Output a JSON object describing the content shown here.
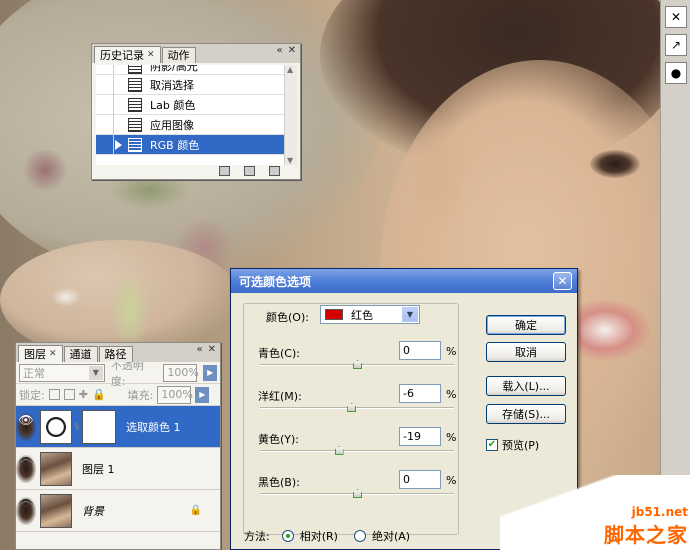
{
  "history": {
    "tabs": [
      {
        "label": "历史记录"
      },
      {
        "label": "动作"
      }
    ],
    "items": [
      {
        "label": "阴影/高光"
      },
      {
        "label": "取消选择"
      },
      {
        "label": "Lab 颜色"
      },
      {
        "label": "应用图像"
      },
      {
        "label": "RGB 颜色"
      }
    ]
  },
  "layers": {
    "tabs": [
      {
        "label": "图层"
      },
      {
        "label": "通道"
      },
      {
        "label": "路径"
      }
    ],
    "blend_mode": "正常",
    "opacity_label": "不透明度:",
    "opacity_value": "100%",
    "lock_label": "锁定:",
    "fill_label": "填充:",
    "fill_value": "100%",
    "items": [
      {
        "name": "选取颜色 1"
      },
      {
        "name": "图层 1"
      },
      {
        "name": "背景"
      }
    ]
  },
  "dialog": {
    "title": "可选颜色选项",
    "colors_label": "颜色(O):",
    "color_value": "红色",
    "sliders": [
      {
        "label": "青色(C):",
        "value": "0",
        "pos": 0.5
      },
      {
        "label": "洋红(M):",
        "value": "-6",
        "pos": 0.47
      },
      {
        "label": "黄色(Y):",
        "value": "-19",
        "pos": 0.405
      },
      {
        "label": "黑色(B):",
        "value": "0",
        "pos": 0.5
      }
    ],
    "percent": "%",
    "buttons": {
      "ok": "确定",
      "cancel": "取消",
      "load": "载入(L)...",
      "save": "存储(S)..."
    },
    "preview_label": "预览(P)",
    "method_label": "方法:",
    "relative_label": "相对(R)",
    "absolute_label": "绝对(A)"
  },
  "watermark": {
    "site": "jb51.net",
    "name": "脚本之家"
  }
}
